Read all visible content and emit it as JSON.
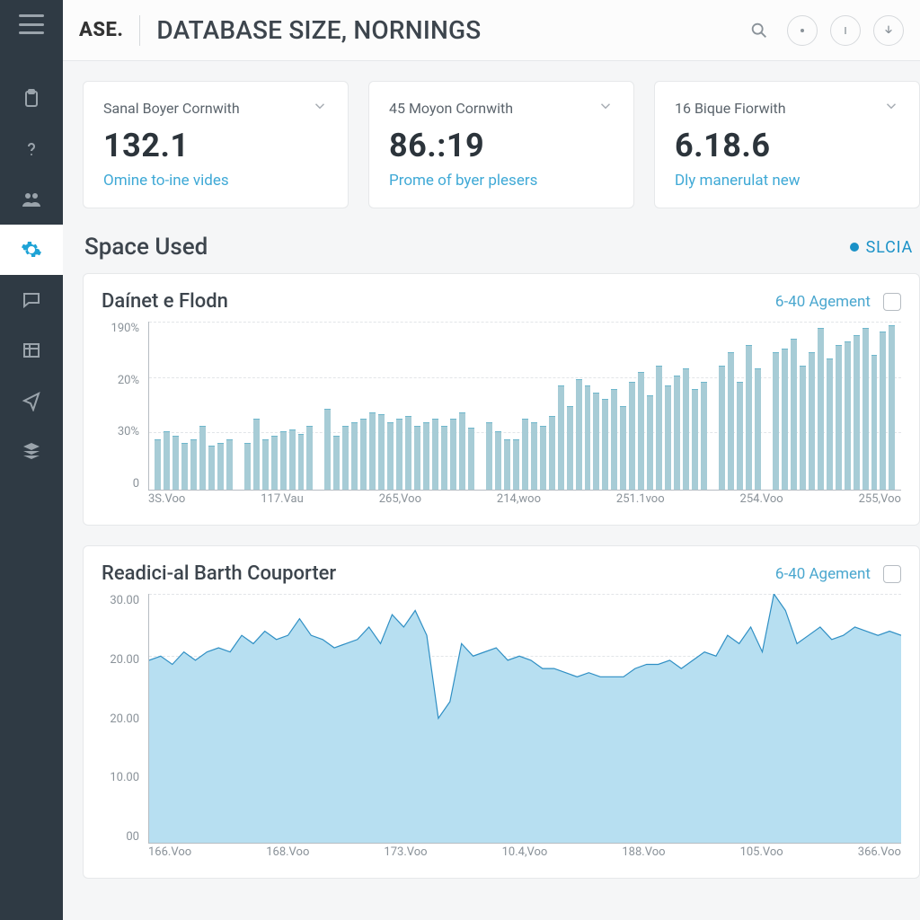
{
  "header": {
    "logo": "ASE.",
    "title": "DATABASE SIZE, NORNINGS"
  },
  "sidebar": {
    "items": [
      {
        "name": "clipboard-icon"
      },
      {
        "name": "help-icon"
      },
      {
        "name": "users-icon"
      },
      {
        "name": "settings-icon",
        "active": true
      },
      {
        "name": "chat-icon"
      },
      {
        "name": "table-icon"
      },
      {
        "name": "send-icon"
      },
      {
        "name": "stack-icon"
      }
    ]
  },
  "cards": [
    {
      "label": "Sanal Boyer Cornwith",
      "value": "132.1",
      "sub": "Omine to-ine vides"
    },
    {
      "label": "45 Moyon Cornwith",
      "value": "86.:19",
      "sub": "Prome of byer plesers"
    },
    {
      "label": "16 Bique Fiorwith",
      "value": "6.18.6",
      "sub": "Dly manerulat new"
    }
  ],
  "section": {
    "title": "Space Used",
    "legend": "SLCIA"
  },
  "chart1_toolbar": {
    "title": "Daínet e Flodn",
    "range": "6-40 Agement"
  },
  "chart2_toolbar": {
    "title": "Readici-al Barth Couporter",
    "range": "6-40 Agement"
  },
  "chart_data": [
    {
      "type": "bar",
      "title": "Daínet e Flodn",
      "y_ticks": [
        "190%",
        "20%",
        "30%",
        "0"
      ],
      "x_ticks": [
        "3S.Voo",
        "117.Vau",
        "265,Voo",
        "214,woo",
        "251.1voo",
        "254.Voo",
        "255,Voo"
      ],
      "ylim": [
        0,
        100
      ],
      "values": [
        30,
        35,
        32,
        28,
        30,
        38,
        26,
        28,
        30,
        null,
        28,
        42,
        30,
        32,
        35,
        36,
        33,
        38,
        null,
        48,
        32,
        38,
        40,
        42,
        46,
        45,
        40,
        42,
        44,
        38,
        40,
        42,
        38,
        42,
        46,
        37,
        null,
        40,
        35,
        30,
        30,
        42,
        40,
        38,
        44,
        62,
        50,
        66,
        62,
        58,
        54,
        60,
        50,
        64,
        70,
        56,
        74,
        62,
        68,
        72,
        60,
        64,
        null,
        74,
        82,
        64,
        86,
        72,
        null,
        82,
        84,
        90,
        74,
        82,
        96,
        78,
        86,
        88,
        92,
        96,
        80,
        94,
        98
      ]
    },
    {
      "type": "area",
      "title": "Readici-al Barth Couporter",
      "y_ticks": [
        "30.00",
        "20.00",
        "20.00",
        "10.00",
        "00"
      ],
      "x_ticks": [
        "166.Voo",
        "168.Voo",
        "173.Voo",
        "10.4,Voo",
        "188.Voo",
        "105.Voo",
        "366.Voo"
      ],
      "ylim": [
        0,
        30
      ],
      "values": [
        22,
        22.5,
        21.5,
        23,
        22,
        23,
        23.5,
        23,
        25,
        24,
        25.5,
        24.5,
        25,
        27,
        25,
        24.5,
        23.5,
        24,
        24.5,
        26,
        24,
        27.5,
        26,
        28,
        25,
        15,
        17,
        24,
        22.5,
        23,
        23.5,
        22,
        22.5,
        22,
        21,
        21,
        20.5,
        20,
        20.5,
        20,
        20,
        20,
        21,
        21.5,
        21.5,
        22,
        21,
        22,
        23,
        22.5,
        25,
        24,
        26,
        23,
        30,
        28,
        24,
        25,
        26,
        24.5,
        25,
        26,
        25.5,
        25,
        25.5,
        25
      ]
    }
  ]
}
